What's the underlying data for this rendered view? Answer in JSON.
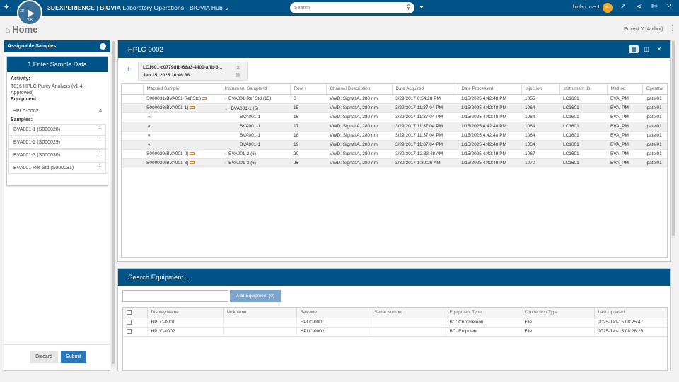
{
  "topbar": {
    "brand": "3DEXPERIENCE",
    "product": "BIOVIA",
    "title": "Laboratory Operations - BIOVIA Hub",
    "compass_version": "V.R",
    "search_placeholder": "Search",
    "user_name": "biolab user1",
    "avatar_initials": "BU",
    "icons": [
      "search-icon",
      "tag-icon",
      "comment-icon",
      "share-icon",
      "tools-icon",
      "help-icon"
    ]
  },
  "header": {
    "home_label": "Home",
    "project_label": "Project X (Author)"
  },
  "left_panel": {
    "title": "Assignable Samples",
    "step_title": "1 Enter Sample Data",
    "activity_label": "Activity:",
    "activity_value": "T016 HPLC Purity Analysis (v1.4 - Approved)",
    "equipment_label": "Equipment:",
    "equipment": {
      "name": "HPLC-0002",
      "count": "4"
    },
    "samples_label": "Samples:",
    "samples": [
      {
        "name": "BVA001-1 (S000028)",
        "count": "1"
      },
      {
        "name": "BVA001-2 (S000029)",
        "count": "1"
      },
      {
        "name": "BVA001-3 (S000030)",
        "count": "1"
      },
      {
        "name": "BVA001 Ref Std (S000031)",
        "count": "1"
      }
    ],
    "discard_label": "Discard",
    "submit_label": "Submit"
  },
  "hplc": {
    "title": "HPLC-0002",
    "file_tab": {
      "name": "LC1601-c0779dfb-66a3-4400-affb-3...",
      "date": "Jan 15, 2025 16:46:38"
    },
    "columns": [
      "Mapped Sample",
      "Instrument Sample Id",
      "Row",
      "Channel Description",
      "Date Acquired",
      "Date Processed",
      "Injection",
      "Instrument ID",
      "Method",
      "Operator"
    ],
    "sort_indicator": "↑",
    "rows": [
      {
        "mapped": "S000031(BVA001 Ref Std)",
        "flag": true,
        "expander": "›",
        "sample_id": "BVA001 Ref Std (15)",
        "row": "0",
        "channel": "VWD: Signal A, 280 nm",
        "acquired": "3/29/2017 6:54:28 PM",
        "processed": "1/15/2025 4:42:48 PM",
        "injection": "1055",
        "instrument": "LC1601",
        "method": "BVA_PM",
        "operator": "jpatel01",
        "indent": false,
        "alt": false
      },
      {
        "mapped": "S000028(BVA001-1)",
        "flag": true,
        "expander": "⌄",
        "sample_id": "BVA001-1 (5)",
        "row": "15",
        "channel": "VWD: Signal A, 280 nm",
        "acquired": "3/29/2017 11:37:04 PM",
        "processed": "1/15/2025 4:42:48 PM",
        "injection": "1064",
        "instrument": "LC1601",
        "method": "BVA_PM",
        "operator": "jpatel01",
        "indent": false,
        "alt": true
      },
      {
        "mapped": "«",
        "flag": false,
        "expander": "",
        "sample_id": "BVA001-1",
        "row": "16",
        "channel": "VWD: Signal A, 280 nm",
        "acquired": "3/29/2017 11:37:04 PM",
        "processed": "1/15/2025 4:42:48 PM",
        "injection": "1064",
        "instrument": "LC1601",
        "method": "BVA_PM",
        "operator": "jpatel01",
        "indent": true,
        "alt": false
      },
      {
        "mapped": "«",
        "flag": false,
        "expander": "",
        "sample_id": "BVA001-1",
        "row": "17",
        "channel": "VWD: Signal A, 280 nm",
        "acquired": "3/29/2017 11:37:04 PM",
        "processed": "1/15/2025 4:42:48 PM",
        "injection": "1064",
        "instrument": "LC1601",
        "method": "BVA_PM",
        "operator": "jpatel01",
        "indent": true,
        "alt": true
      },
      {
        "mapped": "«",
        "flag": false,
        "expander": "",
        "sample_id": "BVA001-1",
        "row": "18",
        "channel": "VWD: Signal A, 280 nm",
        "acquired": "3/29/2017 11:37:04 PM",
        "processed": "1/15/2025 4:42:48 PM",
        "injection": "1064",
        "instrument": "LC1601",
        "method": "BVA_PM",
        "operator": "jpatel01",
        "indent": true,
        "alt": false
      },
      {
        "mapped": "«",
        "flag": false,
        "expander": "",
        "sample_id": "BVA001-1",
        "row": "19",
        "channel": "VWD: Signal A, 280 nm",
        "acquired": "3/29/2017 11:37:04 PM",
        "processed": "1/15/2025 4:42:48 PM",
        "injection": "1064",
        "instrument": "LC1601",
        "method": "BVA_PM",
        "operator": "jpatel01",
        "indent": true,
        "alt": true
      },
      {
        "mapped": "S000029(BVA001-2)",
        "flag": true,
        "expander": "›",
        "sample_id": "BVA001-2 (6)",
        "row": "20",
        "channel": "VWD: Signal A, 280 nm",
        "acquired": "3/30/2017 12:33:48 AM",
        "processed": "1/15/2025 4:42:49 PM",
        "injection": "1067",
        "instrument": "LC1601",
        "method": "BVA_PM",
        "operator": "jpatel01",
        "indent": false,
        "alt": false
      },
      {
        "mapped": "S000030(BVA001-3)",
        "flag": true,
        "expander": "›",
        "sample_id": "BVA001-3 (6)",
        "row": "26",
        "channel": "VWD: Signal A, 280 nm",
        "acquired": "3/30/2017 1:30:26 AM",
        "processed": "1/15/2025 4:42:49 PM",
        "injection": "1070",
        "instrument": "LC1601",
        "method": "BVA_PM",
        "operator": "jpatel01",
        "indent": false,
        "alt": true
      }
    ]
  },
  "equipment_search": {
    "title": "Search Equipment...",
    "input_value": "",
    "add_button_label": "Add Equipment (0)",
    "columns": [
      "Display Name",
      "Nickname",
      "Barcode",
      "Serial Number",
      "Equipment Type",
      "Connection Type",
      "Last Updated"
    ],
    "rows": [
      {
        "display_name": "HPLC-0001",
        "nickname": "",
        "barcode": "HPLC-0001",
        "serial": "",
        "type": "BC: Chromeleon",
        "connection": "File",
        "updated": "2025-Jan-15 08:25:47"
      },
      {
        "display_name": "HPLC-0002",
        "nickname": "",
        "barcode": "HPLC-0002",
        "serial": "",
        "type": "BC: Empower",
        "connection": "File",
        "updated": "2025-Jan-15 08:28:25"
      }
    ]
  }
}
